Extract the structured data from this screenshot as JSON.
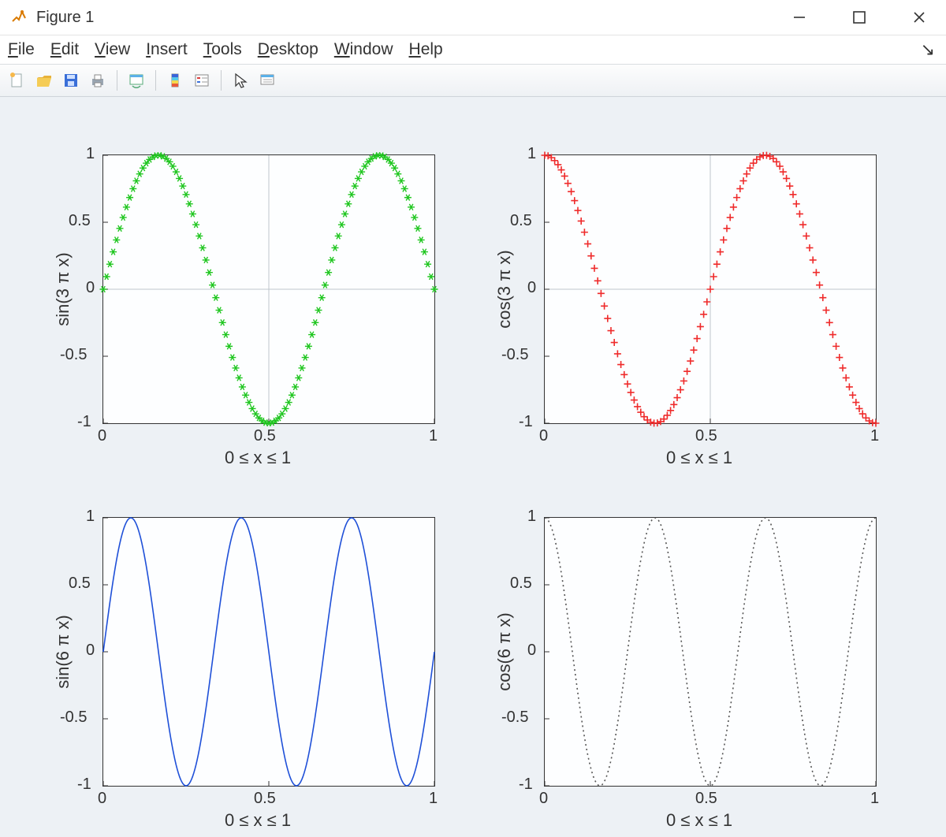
{
  "window": {
    "title": "Figure 1"
  },
  "menu": {
    "items": [
      "File",
      "Edit",
      "View",
      "Insert",
      "Tools",
      "Desktop",
      "Window",
      "Help"
    ]
  },
  "toolbar": {
    "icons": [
      "new-file-icon",
      "open-file-icon",
      "save-icon",
      "print-icon",
      "sep",
      "link-figure-icon",
      "sep",
      "colorbar-icon",
      "legend-icon",
      "sep",
      "pointer-icon",
      "data-tips-icon"
    ]
  },
  "axes_common": {
    "xlabel": "0 ≤ x ≤ 1",
    "xticks": [
      0,
      0.5,
      1
    ],
    "yticks": [
      -1,
      -0.5,
      0,
      0.5,
      1
    ],
    "xlim": [
      0,
      1
    ],
    "ylim": [
      -1,
      1
    ]
  },
  "subplots": [
    {
      "id": "ax1",
      "row": 0,
      "col": 0,
      "ylabel": "sin(3 π x)",
      "style": {
        "marker": "*",
        "color": "#1fc61f",
        "line": false,
        "grid": true
      }
    },
    {
      "id": "ax2",
      "row": 0,
      "col": 1,
      "ylabel": "cos(3 π x)",
      "style": {
        "marker": "+",
        "color": "#ef2b2b",
        "line": false,
        "grid": true
      }
    },
    {
      "id": "ax3",
      "row": 1,
      "col": 0,
      "ylabel": "sin(6 π x)",
      "style": {
        "marker": null,
        "color": "#1f50d8",
        "line": true,
        "dash": null,
        "grid": false
      }
    },
    {
      "id": "ax4",
      "row": 1,
      "col": 1,
      "ylabel": "cos(6 π x)",
      "style": {
        "marker": null,
        "color": "#555",
        "line": true,
        "dash": "2 4",
        "grid": false
      }
    }
  ],
  "chart_data": [
    {
      "type": "scatter",
      "title": "",
      "xlabel": "0 ≤ x ≤ 1",
      "ylabel": "sin(3 π x)",
      "xlim": [
        0,
        1
      ],
      "ylim": [
        -1,
        1
      ],
      "series": [
        {
          "name": "sin(3πx)",
          "formula": "sin(3*pi*x)",
          "x_range": [
            0,
            1
          ],
          "n": 101
        }
      ]
    },
    {
      "type": "scatter",
      "title": "",
      "xlabel": "0 ≤ x ≤ 1",
      "ylabel": "cos(3 π x)",
      "xlim": [
        0,
        1
      ],
      "ylim": [
        -1,
        1
      ],
      "series": [
        {
          "name": "cos(3πx)",
          "formula": "cos(3*pi*x)",
          "x_range": [
            0,
            1
          ],
          "n": 101
        }
      ]
    },
    {
      "type": "line",
      "title": "",
      "xlabel": "0 ≤ x ≤ 1",
      "ylabel": "sin(6 π x)",
      "xlim": [
        0,
        1
      ],
      "ylim": [
        -1,
        1
      ],
      "series": [
        {
          "name": "sin(6πx)",
          "formula": "sin(6*pi*x)",
          "x_range": [
            0,
            1
          ],
          "n": 301
        }
      ]
    },
    {
      "type": "line",
      "title": "",
      "xlabel": "0 ≤ x ≤ 1",
      "ylabel": "cos(6 π x)",
      "xlim": [
        0,
        1
      ],
      "ylim": [
        -1,
        1
      ],
      "series": [
        {
          "name": "cos(6πx)",
          "formula": "cos(6*pi*x)",
          "x_range": [
            0,
            1
          ],
          "n": 301
        }
      ]
    }
  ]
}
